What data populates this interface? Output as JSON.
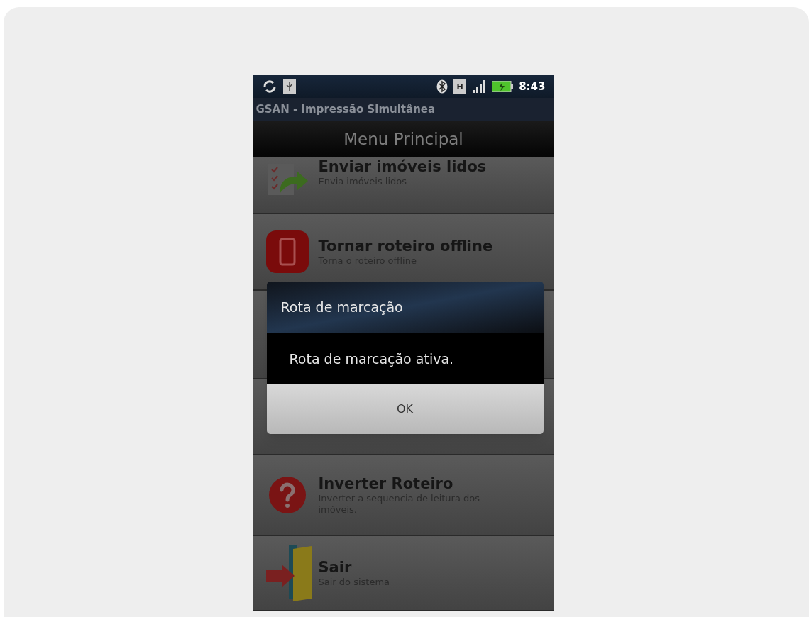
{
  "status_bar": {
    "network_type": "H",
    "time": "8:43"
  },
  "app_title": "GSAN - Impressão Simultânea",
  "header": "Menu Principal",
  "menu_items": [
    {
      "kind": "send",
      "title": "Enviar imóveis lidos",
      "subtitle": "Envia imóveis lidos"
    },
    {
      "kind": "offline",
      "title": "Tornar roteiro offline",
      "subtitle": "Torna o roteiro offline"
    },
    {
      "kind": "covered"
    },
    {
      "kind": "covered"
    },
    {
      "kind": "help",
      "title": "Inverter Roteiro",
      "subtitle": "Inverter a sequencia de leitura dos imóveis."
    },
    {
      "kind": "exit",
      "title": "Sair",
      "subtitle": "Sair do sistema"
    }
  ],
  "dialog": {
    "title": "Rota de marcação",
    "message": "Rota de marcação ativa.",
    "button": "OK"
  }
}
